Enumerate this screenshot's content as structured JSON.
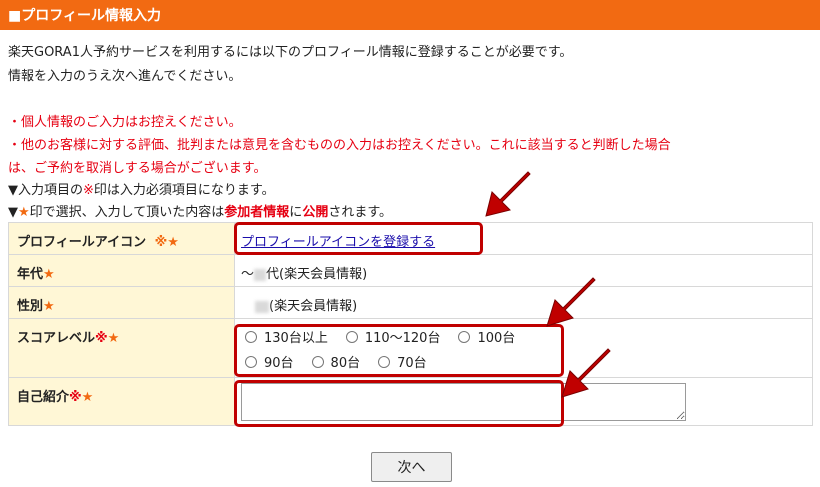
{
  "header": {
    "title": "■プロフィール情報入力"
  },
  "intro": {
    "line1": "楽天GORA1人予約サービスを利用するには以下のプロフィール情報に登録することが必要です。",
    "line2": "情報を入力のうえ次へ進んでください。"
  },
  "notices": {
    "n1": "・個人情報のご入力はお控えください。",
    "n2": "・他のお客様に対する評価、批判または意見を含むものの入力はお控えください。これに該当すると判断した場合",
    "n3": "は、ご予約を取消しする場合がございます。"
  },
  "legend": {
    "required_pre": "▼入力項目の",
    "required_mark": "※",
    "required_post": "印は入力必須項目になります。",
    "public_pre": "▼",
    "public_star": "★",
    "public_mid1": "印で選択、入力して頂いた内容は",
    "public_participant": "参加者情報",
    "public_mid2": "に",
    "public_public": "公開",
    "public_post": "されます。"
  },
  "form": {
    "icon": {
      "label": "プロフィールアイコン",
      "marks": "※★",
      "link": "プロフィールアイコンを登録する"
    },
    "age": {
      "label": "年代",
      "star": "★",
      "prefix": "～",
      "suffix": "代(楽天会員情報)"
    },
    "gender": {
      "label": "性別",
      "star": "★",
      "suffix": "(楽天会員情報)"
    },
    "score": {
      "label": "スコアレベル",
      "req": "※",
      "star": "★",
      "options_row1": [
        "130台以上",
        "110～120台",
        "100台"
      ],
      "options_row2": [
        "90台",
        "80台",
        "70台"
      ]
    },
    "self_intro": {
      "label": "自己紹介",
      "req": "※",
      "star": "★",
      "value": ""
    }
  },
  "buttons": {
    "next": "次へ"
  },
  "colors": {
    "header": "#f26a12",
    "required": "#e60012",
    "star": "#f26a12",
    "highlight": "#c00000",
    "label_bg": "#fff7d6"
  }
}
